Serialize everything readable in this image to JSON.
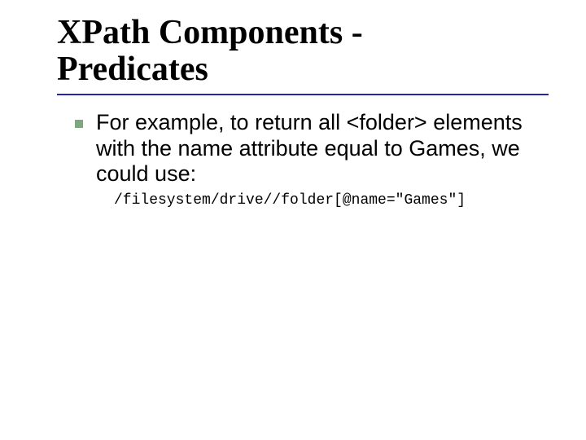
{
  "slide": {
    "title_line1": "XPath Components -",
    "title_line2": "Predicates",
    "bullet_text": "For example, to return all <folder> elements with the name attribute equal to  Games, we could use:",
    "code": "/filesystem/drive//folder[@name=\"Games\"]"
  }
}
